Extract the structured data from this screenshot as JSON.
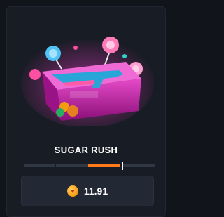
{
  "case": {
    "name": "SUGAR RUSH",
    "price": "11.91",
    "coin_icon": "heart-coin-icon",
    "colors": {
      "accent": "#ff7a1a",
      "case_body": "#c51fa4",
      "background": "#11141a",
      "card": "#181c24"
    },
    "rarity_segments": 3,
    "active_segment": 3
  }
}
